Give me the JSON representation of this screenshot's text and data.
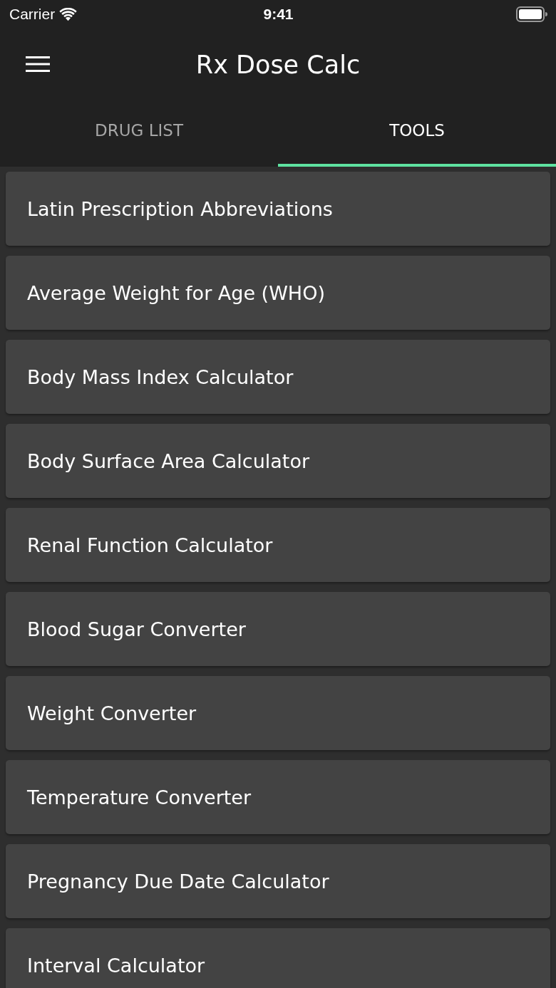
{
  "status_bar": {
    "carrier": "Carrier",
    "time": "9:41"
  },
  "header": {
    "title": "Rx Dose Calc"
  },
  "tabs": [
    {
      "label": "DRUG LIST",
      "selected": false
    },
    {
      "label": "TOOLS",
      "selected": true
    }
  ],
  "tools": [
    "Latin Prescription Abbreviations",
    "Average Weight for Age (WHO)",
    "Body Mass Index Calculator",
    "Body Surface Area Calculator",
    "Renal Function Calculator",
    "Blood Sugar Converter",
    "Weight Converter",
    "Temperature Converter",
    "Pregnancy Due Date Calculator",
    "Interval Calculator"
  ]
}
